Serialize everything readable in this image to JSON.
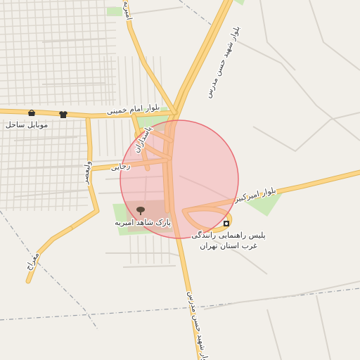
{
  "map": {
    "colors": {
      "background": "#f2efe9",
      "major_road": "#fcd689",
      "major_road_casing": "#e0b65c",
      "minor_road": "#ffffff",
      "minor_road_casing": "#d9d4cc",
      "park": "#cde8b9",
      "park_inner": "#d9cdb5",
      "block": "#ddd8cf",
      "boundary": "#9aa0a8",
      "highlight_fill": "#f7a3a8",
      "highlight_stroke": "#e86c74"
    },
    "road_labels": {
      "hasan_modarres_north": "بلوار شهید حسن مدرس",
      "hasan_modarres_south": "بلوار شهید حسن مدرس",
      "imam_khomeini": "بلوار امام خمینی",
      "amir_kabir": "بلوار امیرکبیر",
      "rajaei": "رجایی",
      "pasdaran": "پاسداران",
      "valiasr": "ولیعصر",
      "meraj": "معراج",
      "amirieh": "امیریه"
    },
    "pois": [
      {
        "name": "موبایل ساحل",
        "icon": "shop-icon"
      },
      {
        "name": "پارک شاهد امیریه",
        "icon": "park-tree-icon"
      },
      {
        "name": "پلیس راهنمایی رانندگی غرب استان تهران",
        "line1": "پلیس راهنمایی رانندگی",
        "line2": "غرب استان تهران",
        "icon": "police-icon"
      }
    ],
    "extra_icons": [
      "clothes-shop-icon"
    ]
  }
}
